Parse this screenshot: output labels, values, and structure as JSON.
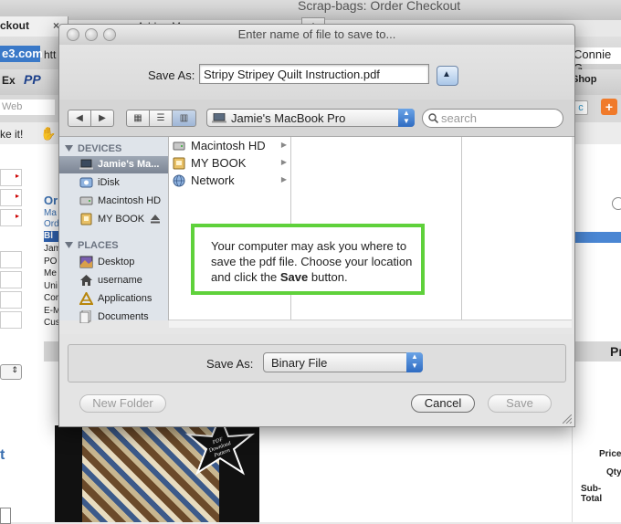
{
  "background": {
    "window_title": "Scrap-bags: Order Checkout",
    "tab1_label": "ckout",
    "tab2_label": "Add ... M...",
    "url_left": "e3.com",
    "url_fragment": "htt",
    "user_name": "Connie G",
    "bookmark_ex": "Ex",
    "bookmark_pp": "PP",
    "bookmark_shop": "Shop",
    "search_placeholder": "Web",
    "likeit": "ke it!",
    "order_heading": "Or",
    "order_lines": [
      "Ma",
      "Ord"
    ],
    "bl": "Bl",
    "column_words": [
      "Jam",
      "PO",
      "Me",
      "Uni",
      "Cor",
      "E-M",
      "Cus"
    ],
    "pr_heading": "Pr",
    "left_letter": "t",
    "price_label": "Price",
    "qty_label": "Qty",
    "subtotal_label": "Sub-Total",
    "star_text": "PDF Download Pattern"
  },
  "dialog": {
    "title": "Enter name of file to save to...",
    "save_as_label": "Save As:",
    "filename": "Stripy Stripey Quilt Instruction.pdf",
    "location": "Jamie's MacBook Pro",
    "search_placeholder": "search",
    "sidebar": {
      "devices_header": "DEVICES",
      "devices": [
        "Jamie's Ma...",
        "iDisk",
        "Macintosh HD",
        "MY BOOK"
      ],
      "places_header": "PLACES",
      "places": [
        "Desktop",
        "username",
        "Applications",
        "Documents"
      ]
    },
    "column1": [
      "Macintosh HD",
      "MY BOOK",
      "Network"
    ],
    "note": {
      "text_before": "Your computer may ask you where to save the pdf file. Choose your location and click the ",
      "bold": "Save",
      "text_after": " button."
    },
    "format_label": "Save As:",
    "format_value": "Binary File",
    "buttons": {
      "new_folder": "New Folder",
      "cancel": "Cancel",
      "save": "Save"
    }
  },
  "colors": {
    "note_border": "#5fd13b",
    "selection": "#7c8594",
    "accent": "#2f6cc2"
  }
}
